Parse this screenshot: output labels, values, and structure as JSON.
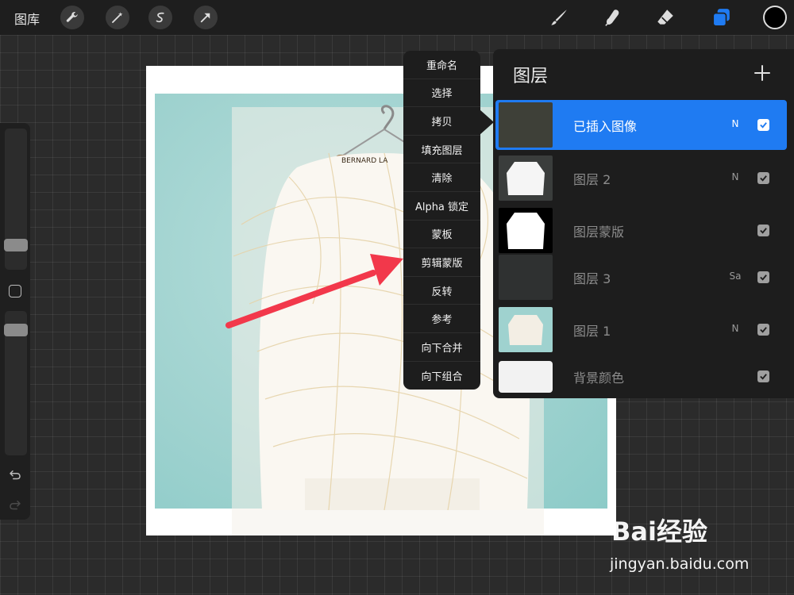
{
  "toolbar": {
    "gallery_label": "图库",
    "actions": [
      "wrench-icon",
      "magic-wand-icon",
      "selection-icon",
      "transform-arrow-icon"
    ],
    "tools": [
      "brush-icon",
      "smudge-icon",
      "eraser-icon",
      "layers-icon"
    ],
    "color_swatch": "#000000",
    "accent": "#1f7bf2"
  },
  "context_menu": {
    "items": [
      "重命名",
      "选择",
      "拷贝",
      "填充图层",
      "清除",
      "Alpha 锁定",
      "蒙板",
      "剪辑蒙版",
      "反转",
      "参考",
      "向下合并",
      "向下组合"
    ]
  },
  "layers_panel": {
    "title": "图层",
    "layers": [
      {
        "name": "已插入图像",
        "blend": "N",
        "visible": true,
        "active": true
      },
      {
        "name": "图层 2",
        "blend": "N",
        "visible": true,
        "active": false
      },
      {
        "name": "图层蒙版",
        "blend": "",
        "visible": true,
        "active": false
      },
      {
        "name": "图层 3",
        "blend": "Sa",
        "visible": true,
        "active": false
      },
      {
        "name": "图层 1",
        "blend": "N",
        "visible": true,
        "active": false
      },
      {
        "name": "背景颜色",
        "blend": "",
        "visible": true,
        "active": false
      }
    ]
  },
  "canvas": {
    "hanger_text": "BERNARD LA"
  },
  "watermark": {
    "brand": "Bai经验",
    "url": "jingyan.baidu.com"
  }
}
